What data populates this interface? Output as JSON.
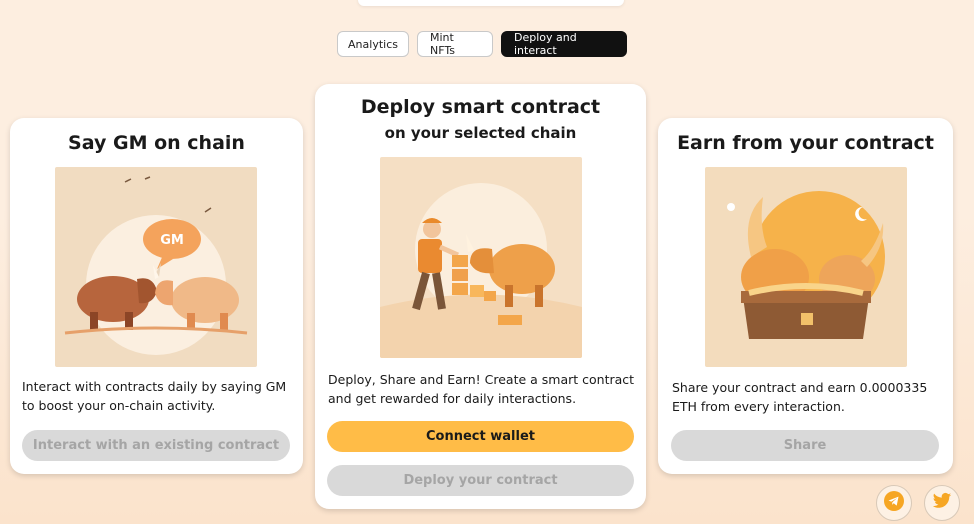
{
  "tabs": [
    {
      "label": "Analytics",
      "active": false
    },
    {
      "label": "Mint NFTs",
      "active": false
    },
    {
      "label": "Deploy and interact",
      "active": true
    }
  ],
  "cards": {
    "gm": {
      "title": "Say GM on chain",
      "bubble_text": "GM",
      "description": "Interact with contracts daily by saying GM to boost your on-chain activity.",
      "button": "Interact with an existing contract",
      "illustration": "two-rhinos-gm-bubble"
    },
    "deploy": {
      "title": "Deploy smart contract",
      "subtitle": "on your selected chain",
      "description": "Deploy, Share and Earn! Create a smart contract and get rewarded for daily interactions.",
      "primary_button": "Connect wallet",
      "secondary_button": "Deploy your contract",
      "illustration": "builder-with-rhino-and-blocks"
    },
    "earn": {
      "title": "Earn from your contract",
      "description": "Share your contract and earn 0.0000335 ETH from every interaction.",
      "button": "Share",
      "illustration": "rhinos-on-treasure-chest"
    }
  },
  "social": [
    {
      "icon": "telegram-icon"
    },
    {
      "icon": "twitter-icon"
    }
  ],
  "colors": {
    "accent": "#ffbc47",
    "disabled_bg": "#d9d9d9",
    "disabled_text": "#a5a5a5",
    "active_tab": "#111111",
    "social_icon": "#f6a623"
  }
}
